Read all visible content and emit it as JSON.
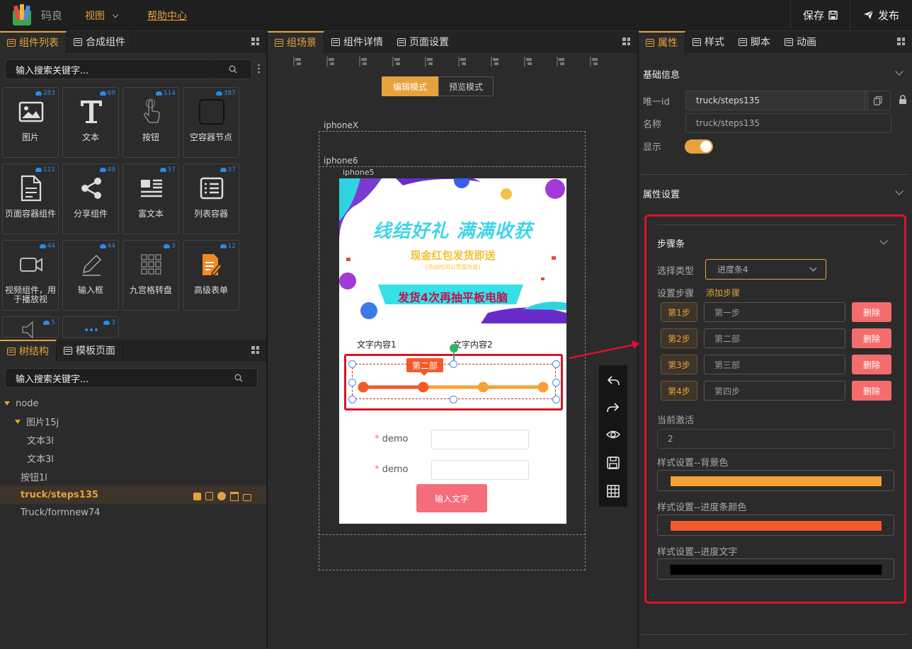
{
  "topbar": {
    "brand": "码良",
    "menu_view": "视图",
    "menu_help": "帮助中心",
    "save": "保存",
    "publish": "发布"
  },
  "left_top": {
    "tabs": [
      "组件列表",
      "合成组件"
    ],
    "search_placeholder": "输入搜索关键字...",
    "components": [
      {
        "label": "图片",
        "count": "283",
        "icon": "image-icon"
      },
      {
        "label": "文本",
        "count": "69",
        "icon": "text-icon"
      },
      {
        "label": "按钮",
        "count": "114",
        "icon": "pointer-icon"
      },
      {
        "label": "空容器节点",
        "count": "387",
        "icon": "square-icon"
      },
      {
        "label": "页面容器组件",
        "count": "121",
        "icon": "document-icon"
      },
      {
        "label": "分享组件",
        "count": "49",
        "icon": "share-icon"
      },
      {
        "label": "富文本",
        "count": "57",
        "icon": "richtext-icon"
      },
      {
        "label": "列表容器",
        "count": "37",
        "icon": "list-icon"
      },
      {
        "label": "视频组件，用于播放视",
        "count": "44",
        "icon": "video-icon"
      },
      {
        "label": "输入框",
        "count": "44",
        "icon": "pen-icon"
      },
      {
        "label": "九宫格转盘",
        "count": "3",
        "icon": "grid-icon"
      },
      {
        "label": "高级表单",
        "count": "12",
        "icon": "form-icon"
      },
      {
        "label": "",
        "count": "5",
        "icon": "sound-icon"
      },
      {
        "label": "",
        "count": "3",
        "icon": "dots-icon"
      }
    ]
  },
  "left_bottom": {
    "tabs": [
      "树结构",
      "模板页面"
    ],
    "search_placeholder": "输入搜索关键字...",
    "tree": [
      {
        "label": "node",
        "indent": 0,
        "arrow": true
      },
      {
        "label": "图片15j",
        "indent": 1,
        "arrow": true
      },
      {
        "label": "文本3l",
        "indent": 2,
        "arrow": false
      },
      {
        "label": "文本3l",
        "indent": 2,
        "arrow": false
      },
      {
        "label": "按钮1l",
        "indent": 1,
        "arrow": false
      },
      {
        "label": "truck/steps135",
        "indent": 1,
        "arrow": false,
        "selected": true
      },
      {
        "label": "Truck/formnew74",
        "indent": 1,
        "arrow": false
      }
    ]
  },
  "center": {
    "tabs": [
      "组场景",
      "组件详情",
      "页面设置"
    ],
    "mode_edit": "编辑模式",
    "mode_preview": "预览模式",
    "labels": {
      "iphonex": "iphoneX",
      "iphone6": "iphone6",
      "iphone5": "iphone5"
    },
    "banner": {
      "headline": "线结好礼 满满收获",
      "sub": "现金红包发货即送",
      "sub2": "(活动时间以页面为准)",
      "cta": "发货4次再抽平板电脑"
    },
    "steps": {
      "label1": "文字内容1",
      "label2": "文字内容2",
      "tooltip": "第二部",
      "count": 4,
      "active": 2,
      "bg_color": "#f7a035",
      "bar_color": "#f25a2a"
    },
    "form": {
      "field1": "demo",
      "field2": "demo",
      "required_mark": "*",
      "button": "输入文字"
    }
  },
  "right": {
    "tabs": [
      "属性",
      "样式",
      "脚本",
      "动画"
    ],
    "basic_title": "基础信息",
    "uid_label": "唯一id",
    "uid_value": "truck/steps135",
    "name_label": "名称",
    "name_placeholder": "truck/steps135",
    "show_label": "显示",
    "props_title": "属性设置",
    "steps_title": "步骤条",
    "type_label": "选择类型",
    "type_value": "进度条4",
    "set_steps_label": "设置步骤",
    "add_step": "添加步骤",
    "steps": [
      {
        "tag": "第1步",
        "value": "第一步",
        "del": "删除"
      },
      {
        "tag": "第2步",
        "value": "第二部",
        "del": "删除"
      },
      {
        "tag": "第3步",
        "value": "第三部",
        "del": "删除"
      },
      {
        "tag": "第4步",
        "value": "第四步",
        "del": "删除"
      }
    ],
    "active_label": "当前激活",
    "active_value": "2",
    "bg_label": "样式设置--背景色",
    "bg_color": "#f7a035",
    "bar_label": "样式设置--进度条颜色",
    "bar_color": "#f25a2a",
    "text_label": "样式设置--进度文字",
    "text_color": "#000000"
  },
  "accent": "#e6a23c",
  "highlight_color": "#d9132a"
}
